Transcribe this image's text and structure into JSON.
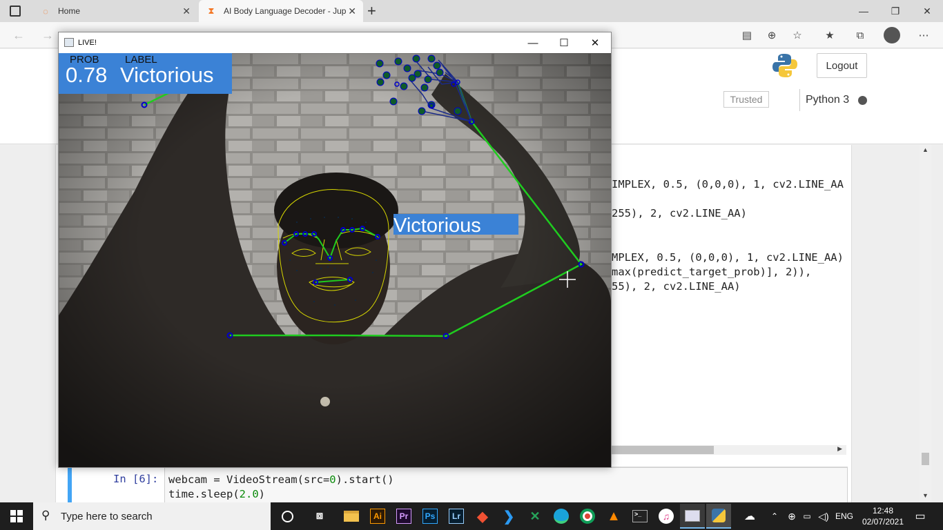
{
  "browser": {
    "tabs": [
      {
        "label": "Home",
        "active": false
      },
      {
        "label": "AI Body Language Decoder - Jup",
        "active": true
      }
    ],
    "new_tab": "+",
    "window_controls": [
      "minimize",
      "restore",
      "close"
    ]
  },
  "jupyter": {
    "logout_label": "Logout",
    "trusted_label": "Trusted",
    "kernel_label": "Python 3"
  },
  "output_code": [
    {
      "text": "IMPLEX, 0.5, (0,0,0), 1, cv2.LINE_AA"
    },
    {
      "text": "255), 2, cv2.LINE_AA)"
    },
    {
      "text": "MPLEX, 0.5, (0,0,0), 1, cv2.LINE_AA)"
    },
    {
      "text": "max(predict_target_prob)], 2)),"
    },
    {
      "text": "55), 2, cv2.LINE_AA)"
    }
  ],
  "input_cell": {
    "prompt": "In [6]:",
    "line1": "webcam = VideoStream(src=0).start()",
    "line2": "time.sleep(2.0)"
  },
  "live_window": {
    "title": "LIVE!",
    "overlay": {
      "prob_header": "PROB",
      "label_header": "LABEL",
      "prob_value": "0.78",
      "class_value": "Victorious",
      "face_label": "Victorious",
      "box_color": "#3b82d6"
    }
  },
  "taskbar": {
    "search_placeholder": "Type here to search",
    "apps": [
      "task-view",
      "file-explorer",
      "illustrator",
      "premiere",
      "photoshop",
      "lightroom",
      "git",
      "vscode",
      "excel",
      "edge",
      "chrome",
      "vlc",
      "terminal",
      "itunes",
      "explorer-window",
      "python"
    ],
    "app_labels": {
      "illustrator": "Ai",
      "premiere": "Pr",
      "photoshop": "Ps",
      "lightroom": "Lr"
    },
    "language": "ENG",
    "time": "12:48",
    "date": "02/07/2021"
  },
  "colors": {
    "accent": "#42a5f5",
    "pose_line": "#1fcc1f",
    "landmark": "#0000cc",
    "face_mesh": "#d8d800"
  }
}
